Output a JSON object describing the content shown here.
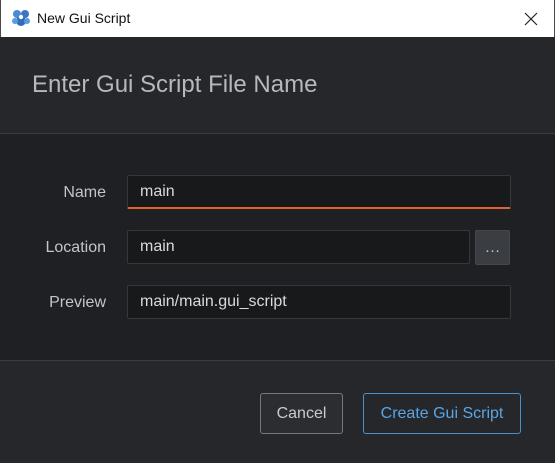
{
  "window": {
    "title": "New Gui Script"
  },
  "header": {
    "title": "Enter Gui Script File Name"
  },
  "form": {
    "name_label": "Name",
    "name_value": "main",
    "location_label": "Location",
    "location_value": "main",
    "browse_label": "…",
    "preview_label": "Preview",
    "preview_value": "main/main.gui_script"
  },
  "footer": {
    "cancel_label": "Cancel",
    "create_label": "Create Gui Script"
  },
  "colors": {
    "accent_focus": "#e0622d",
    "primary_button": "#5ba5e3",
    "background": "#1f2023"
  },
  "icons": {
    "app_icon": "defold-logo-icon",
    "close_icon": "close-icon"
  }
}
